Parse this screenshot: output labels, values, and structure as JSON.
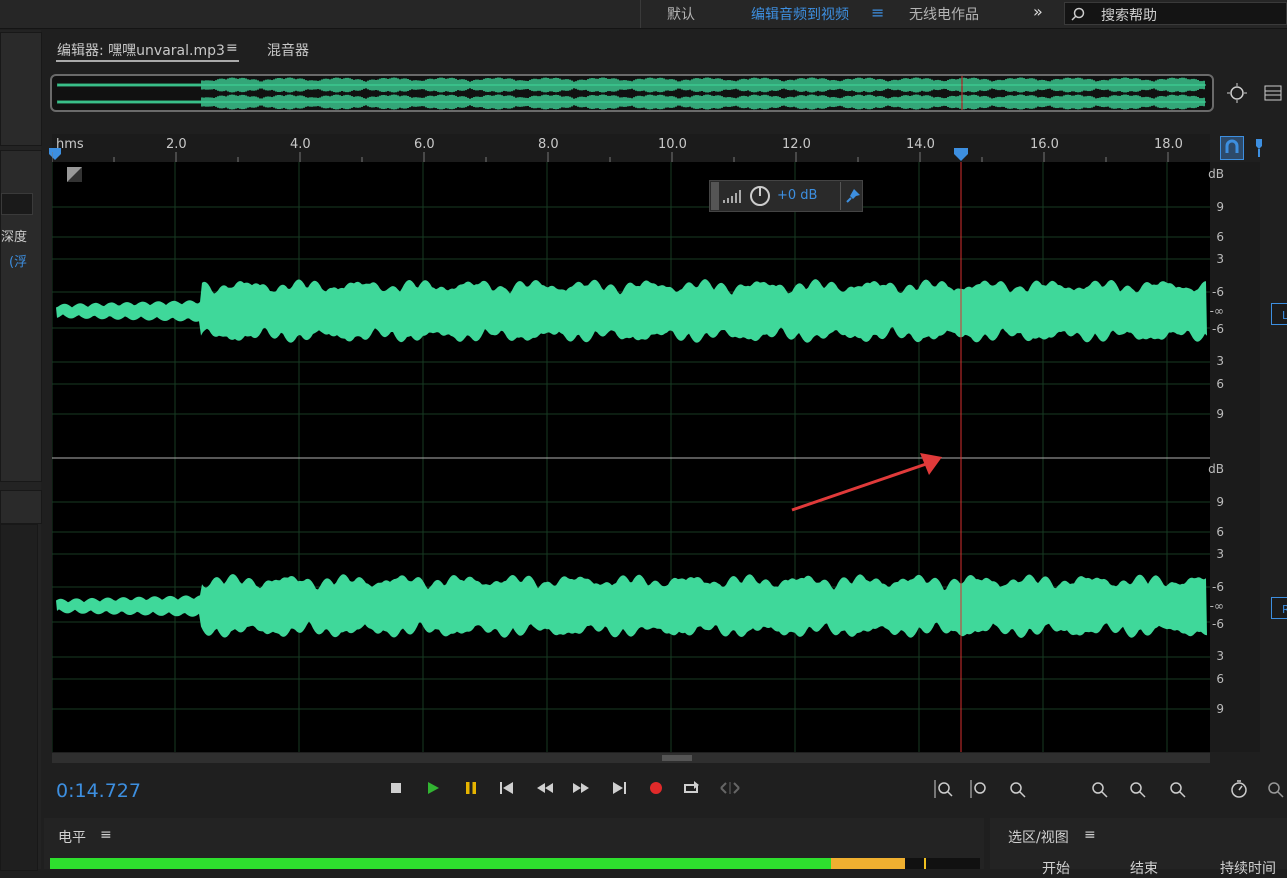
{
  "workspace": {
    "items": [
      "默认",
      "编辑音频到视频",
      "无线电作品"
    ],
    "active_index": 1,
    "menu_glyph": "≡",
    "more_glyph": "»",
    "search_placeholder": "搜索帮助"
  },
  "left_panel": {
    "depth_label": "深度",
    "float_label": "(浮"
  },
  "editor": {
    "tab_label": "编辑器: 嘿嘿unvaral.mp3",
    "tab_menu": "≡",
    "mixer_label": "混音器"
  },
  "ruler": {
    "unit": "hms",
    "ticks": [
      "2.0",
      "4.0",
      "6.0",
      "8.0",
      "10.0",
      "12.0",
      "14.0",
      "16.0",
      "18.0"
    ]
  },
  "hud": {
    "gain": "+0 dB"
  },
  "db_scale": {
    "labels": [
      "dB",
      "9",
      "6",
      "3",
      "-6",
      "-∞",
      "-6",
      "3",
      "6",
      "9"
    ]
  },
  "channels": {
    "left": "L",
    "right": "R"
  },
  "transport": {
    "current_time": "0:14.727",
    "icons": [
      "stop-icon",
      "play-icon",
      "pause-icon",
      "skip-start-icon",
      "rewind-icon",
      "fast-forward-icon",
      "skip-end-icon",
      "record-icon",
      "loop-icon",
      "skip-selection-icon"
    ]
  },
  "levels": {
    "title": "电平",
    "menu": "≡",
    "green_fraction": 0.84,
    "yellow_fraction": 0.08
  },
  "selection_view": {
    "title": "选区/视图",
    "menu": "≡",
    "columns": [
      "开始",
      "结束",
      "持续时间"
    ]
  },
  "colors": {
    "waveform": "#3fd89a",
    "playhead": "#d83030",
    "accent": "#3d8fe0",
    "record": "#e02a2a",
    "play": "#32b432",
    "pause": "#e6b400"
  }
}
